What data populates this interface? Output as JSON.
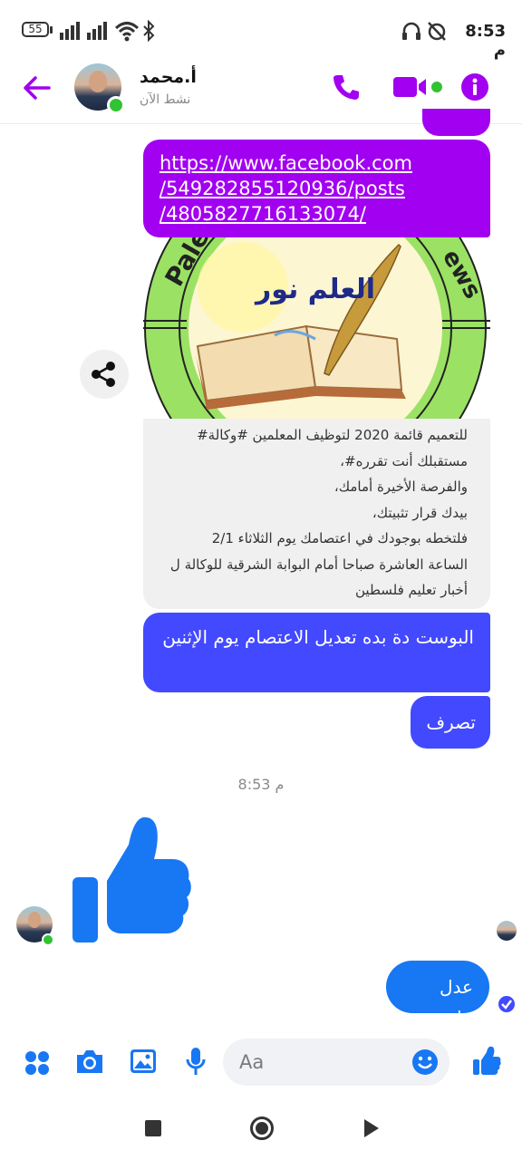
{
  "status_bar": {
    "battery": "55",
    "time": "8:53 م"
  },
  "header": {
    "contact_name": "أ.محمد",
    "status": "نشط الآن"
  },
  "messages": {
    "link_url": "https://www.facebook.com/549282855120936/posts/4805827716133074/",
    "link_lines": [
      "https://www.facebook.com",
      "/549282855120936/posts",
      "/4805827716133074/"
    ],
    "preview_image_title": "العلم نور",
    "preview_text_lines": [
      "للتعميم  قائمة 2020 لتوظيف المعلمين #وكالة#",
      "مستقبلك أنت تقرره#،",
      "والفرصة الأخيرة أمامك،",
      "بيدك قرار تثبيتك،",
      "فلتخطه بوجودك في اعتصامك يوم الثلاثاء 2/1",
      "الساعة العاشرة صباحا أمام البوابة الشرقية للوكالة ل",
      "أخبار تعليم فلسطين"
    ],
    "msg1": "البوست دة بده تعديل الاعتصام يوم الإثنين",
    "msg2": "تصرف",
    "timestamp": "8:53 م",
    "msg3": "عدل عليه"
  },
  "composer": {
    "placeholder": "Aa"
  },
  "colors": {
    "accent": "#a200f0",
    "sent_blue": "#4249ff",
    "fb_blue": "#1877f2",
    "online_green": "#31c332"
  }
}
